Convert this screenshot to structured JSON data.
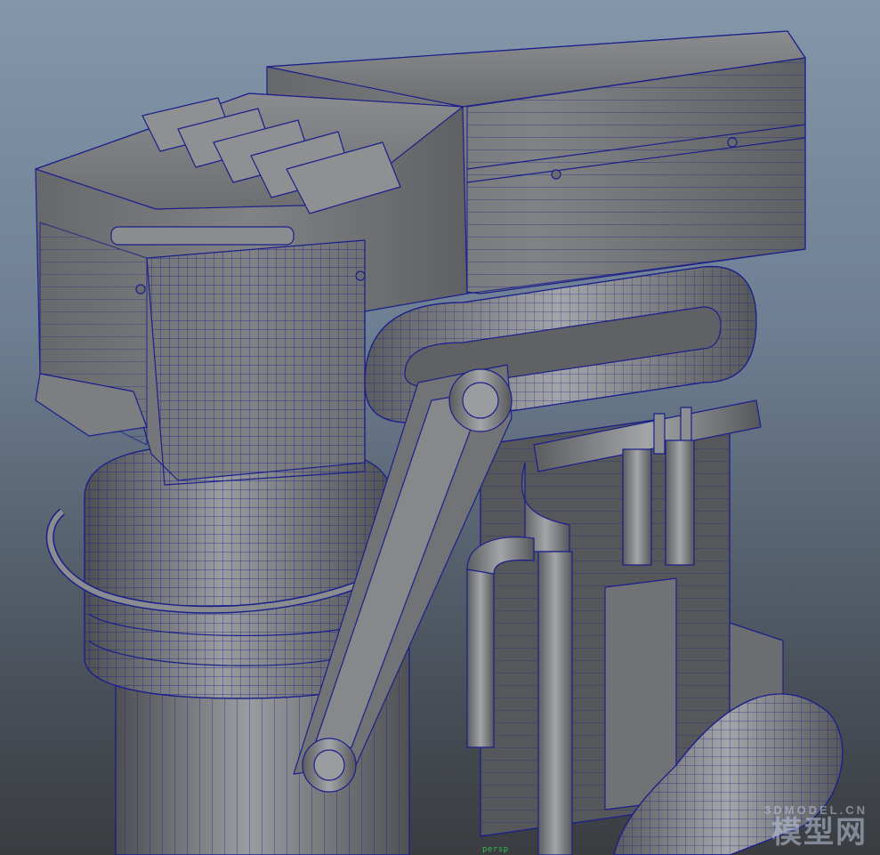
{
  "viewport": {
    "camera_label": "persp",
    "background_top": "#8396aa",
    "background_bottom": "#3a3c40",
    "wireframe_color": "#1b1f8a",
    "surface_color": "#7d7f82"
  },
  "watermark": {
    "url": "3DMODEL.CN",
    "cn": "模型网"
  }
}
